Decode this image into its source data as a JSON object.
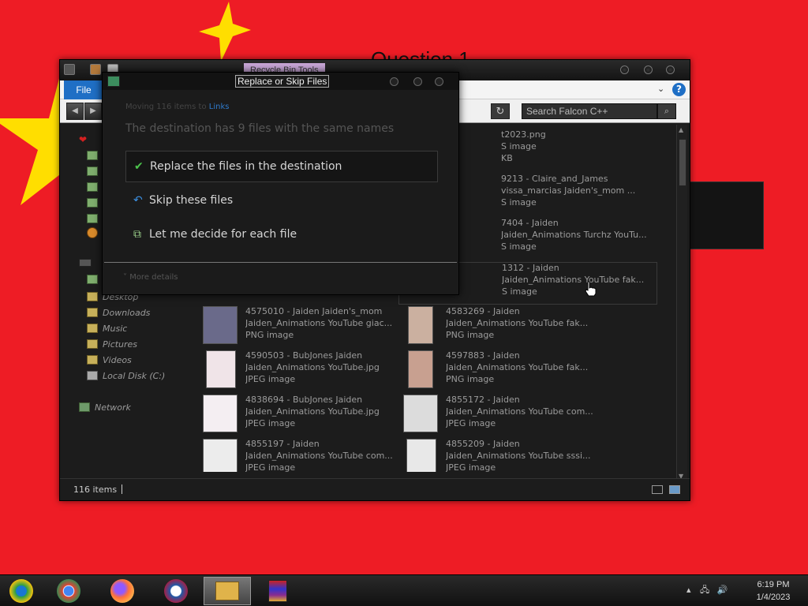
{
  "background": {
    "question_text": "Question 1",
    "colors": {
      "flag_red": "#ee1c25",
      "flag_yellow": "#ffde00"
    }
  },
  "explorer": {
    "title_tag": "Recycle Bin Tools",
    "ribbon": {
      "file_tab": "File"
    },
    "search": {
      "placeholder": "Search Falcon C++"
    },
    "nav_items": [
      {
        "label": "Desktop",
        "icon": "folder-icon"
      },
      {
        "label": "Downloads",
        "icon": "folder-icon"
      },
      {
        "label": "Music",
        "icon": "music-folder-icon"
      },
      {
        "label": "Pictures",
        "icon": "pictures-folder-icon"
      },
      {
        "label": "Videos",
        "icon": "videos-folder-icon"
      },
      {
        "label": "Local Disk (C:)",
        "icon": "drive-icon"
      },
      {
        "label": "Network",
        "icon": "network-icon"
      }
    ],
    "files": [
      {
        "line1": "t2023.png",
        "line2": "S image",
        "line3": "KB"
      },
      {
        "line1": "9213 - Claire_and_James",
        "line2": "vissa_marcias Jaiden's_mom ...",
        "line3": "S image"
      },
      {
        "line1": "7404 - Jaiden",
        "line2": "Jaiden_Animations Turchz YouTu...",
        "line3": "S image"
      },
      {
        "line1": "1312 - Jaiden",
        "line2": "Jaiden_Animations YouTube fak...",
        "line3": "S image"
      },
      {
        "line1": "4575010 - Jaiden Jaiden's_mom",
        "line2": "Jaiden_Animations YouTube giac...",
        "line3": "PNG image"
      },
      {
        "line1": "4583269 - Jaiden",
        "line2": "Jaiden_Animations YouTube fak...",
        "line3": "PNG image"
      },
      {
        "line1": "4590503 - BubJones Jaiden",
        "line2": "Jaiden_Animations YouTube.jpg",
        "line3": "JPEG image"
      },
      {
        "line1": "4597883 - Jaiden",
        "line2": "Jaiden_Animations YouTube fak...",
        "line3": "PNG image"
      },
      {
        "line1": "4838694 - BubJones Jaiden",
        "line2": "Jaiden_Animations YouTube.jpg",
        "line3": "JPEG image"
      },
      {
        "line1": "4855172 - Jaiden",
        "line2": "Jaiden_Animations YouTube com...",
        "line3": "JPEG image"
      },
      {
        "line1": "4855197 - Jaiden",
        "line2": "Jaiden_Animations YouTube com...",
        "line3": "JPEG image"
      },
      {
        "line1": "4855209 - Jaiden",
        "line2": "Jaiden_Animations YouTube sssi...",
        "line3": "JPEG image"
      }
    ],
    "status": {
      "item_count": "116 items"
    }
  },
  "dialog": {
    "title": "Replace or Skip Files",
    "moving_prefix": "Moving 116 items to ",
    "moving_dest": "Links",
    "heading": "The destination has 9 files with the same names",
    "options": [
      {
        "label": "Replace the files in the destination",
        "icon": "checkmark-icon",
        "icon_char": "✔",
        "icon_color": "#4cc44c"
      },
      {
        "label": "Skip these files",
        "icon": "undo-arrow-icon",
        "icon_char": "↶",
        "icon_color": "#3b8fe0"
      },
      {
        "label": "Let me decide for each file",
        "icon": "compare-files-icon",
        "icon_char": "⧉",
        "icon_color": "#9bd08a"
      }
    ],
    "more_details": "More details"
  },
  "taskbar": {
    "apps": [
      {
        "name": "chrome-canary-icon",
        "color": "#2f9e44"
      },
      {
        "name": "chrome-icon",
        "color": "#db4437"
      },
      {
        "name": "firefox-icon",
        "color": "#ff7139"
      },
      {
        "name": "obama-logo-icon",
        "color": "#1e5aa8"
      },
      {
        "name": "file-explorer-icon",
        "color": "#e0b34a"
      },
      {
        "name": "winrar-icon",
        "color": "#8a2b8f"
      }
    ],
    "clock": {
      "time": "6:19 PM",
      "date": "1/4/2023"
    }
  }
}
